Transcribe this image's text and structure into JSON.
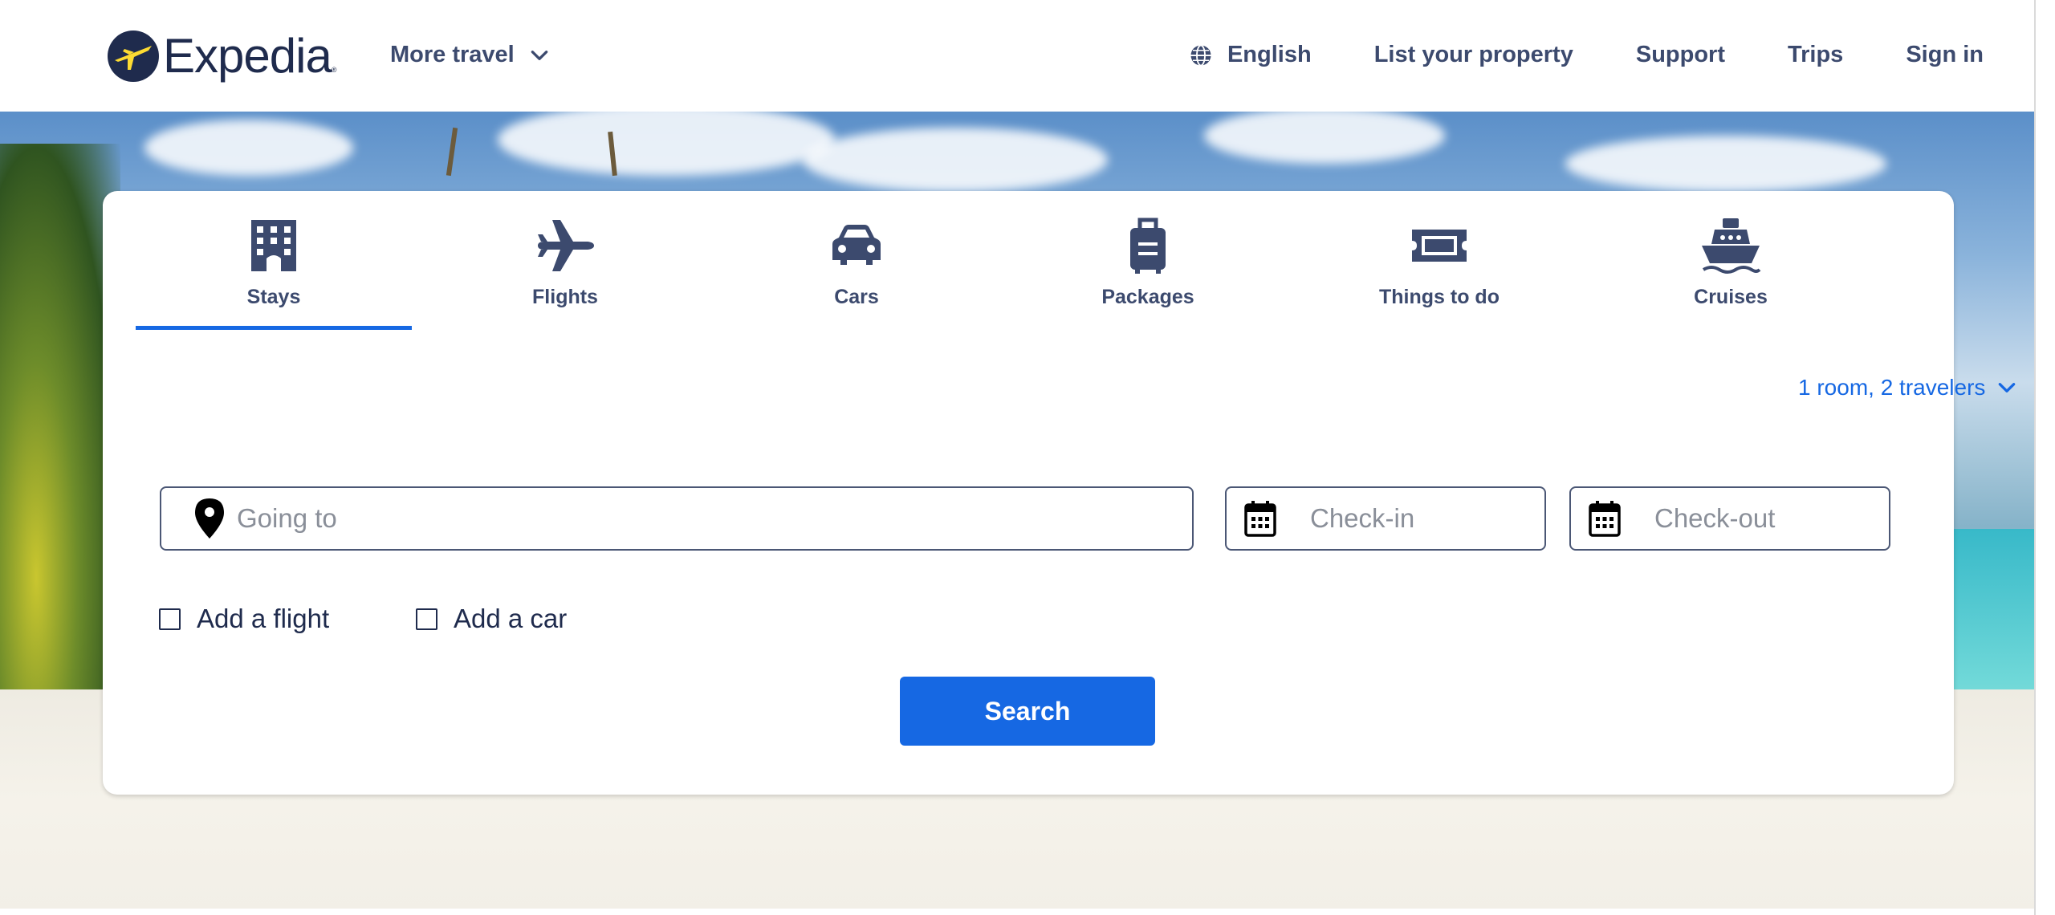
{
  "header": {
    "logo_text": "Expedia",
    "logo_tm": "®",
    "more_travel_label": "More travel",
    "language_label": "English",
    "list_property_label": "List your property",
    "support_label": "Support",
    "trips_label": "Trips",
    "sign_in_label": "Sign in"
  },
  "tabs": [
    {
      "label": "Stays",
      "icon": "hotel-icon",
      "active": true
    },
    {
      "label": "Flights",
      "icon": "plane-icon",
      "active": false
    },
    {
      "label": "Cars",
      "icon": "car-icon",
      "active": false
    },
    {
      "label": "Packages",
      "icon": "suitcase-icon",
      "active": false
    },
    {
      "label": "Things to do",
      "icon": "ticket-icon",
      "active": false
    },
    {
      "label": "Cruises",
      "icon": "ship-icon",
      "active": false
    }
  ],
  "search": {
    "travelers_label": "1 room, 2 travelers",
    "going_to_placeholder": "Going to",
    "check_in_placeholder": "Check-in",
    "check_out_placeholder": "Check-out",
    "add_flight_label": "Add a flight",
    "add_car_label": "Add a car",
    "search_button_label": "Search"
  },
  "colors": {
    "brand_navy": "#1f2b4d",
    "accent_blue": "#1668e3",
    "logo_yellow": "#fddb32"
  }
}
